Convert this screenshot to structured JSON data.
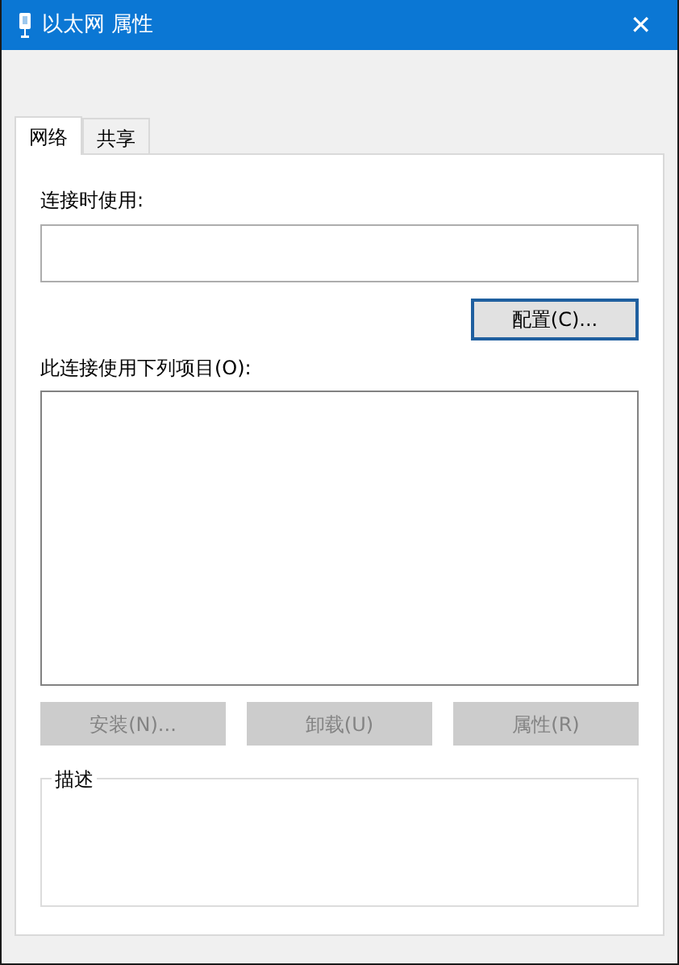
{
  "window": {
    "title": "以太网 属性",
    "close": "✕"
  },
  "tabs": [
    {
      "label": "网络",
      "selected": true
    },
    {
      "label": "共享",
      "selected": false
    }
  ],
  "connect_using": {
    "label": "连接时使用:"
  },
  "configure_button": {
    "label": "配置(C)...",
    "focused": true
  },
  "items_label": "此连接使用下列项目(O):",
  "item_buttons": [
    {
      "label": "安装(N)...",
      "disabled": true
    },
    {
      "label": "卸载(U)",
      "disabled": true
    },
    {
      "label": "属性(R)",
      "disabled": true
    }
  ],
  "description": {
    "label": "描述"
  }
}
